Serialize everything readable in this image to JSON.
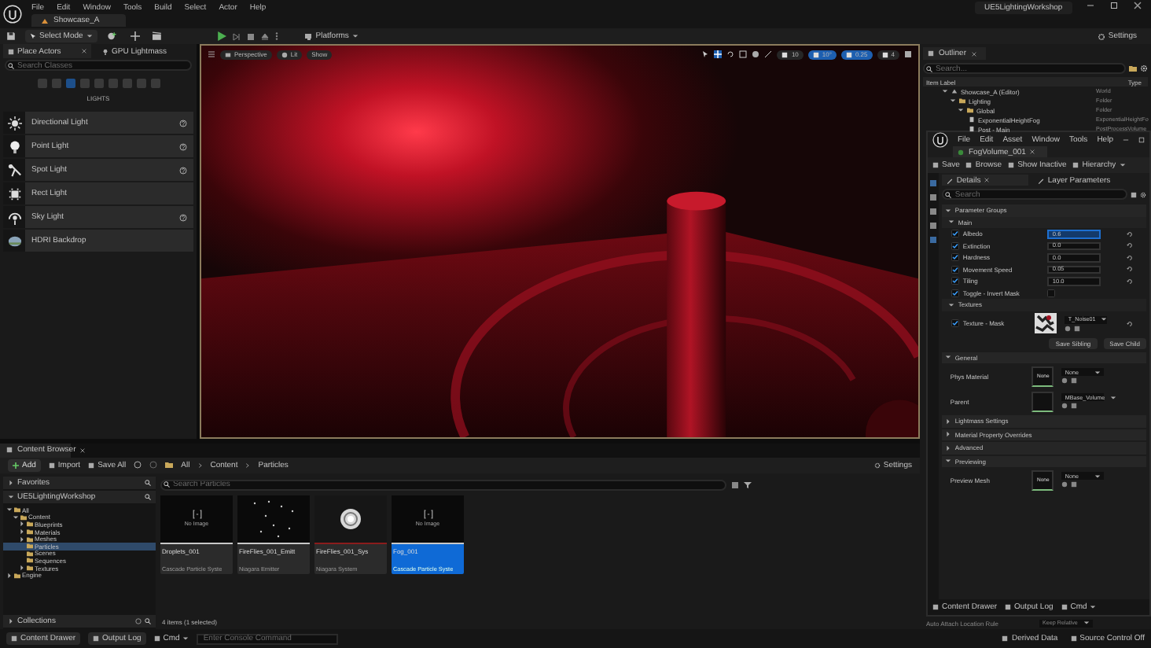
{
  "menu_bar": {
    "items": [
      "File",
      "Edit",
      "Window",
      "Tools",
      "Build",
      "Select",
      "Actor",
      "Help"
    ],
    "project_title": "UE5LightingWorkshop"
  },
  "level_tab": {
    "label": "Showcase_A"
  },
  "toolbar": {
    "mode": "Select Mode",
    "platforms": "Platforms",
    "settings": "Settings"
  },
  "place_actors": {
    "tabs": [
      {
        "label": "Place Actors",
        "selected": true
      },
      {
        "label": "GPU Lightmass",
        "selected": false
      }
    ],
    "search": {
      "placeholder": "Search Classes"
    },
    "category": "LIGHTS",
    "items": [
      {
        "label": "Directional Light",
        "kind": "sun",
        "help": true
      },
      {
        "label": "Point Light",
        "kind": "bulb",
        "help": true
      },
      {
        "label": "Spot Light",
        "kind": "spot",
        "help": true
      },
      {
        "label": "Rect Light",
        "kind": "rect",
        "help": false
      },
      {
        "label": "Sky Light",
        "kind": "sky",
        "help": true
      },
      {
        "label": "HDRI Backdrop",
        "kind": "hdri",
        "help": false
      }
    ]
  },
  "viewport": {
    "view_buttons": [
      "Perspective",
      "Lit",
      "Show"
    ],
    "snap_values": [
      "10",
      "10°",
      "0.25",
      "4"
    ]
  },
  "outliner": {
    "tab": "Outliner",
    "search": {
      "placeholder": "Search..."
    },
    "columns": [
      "Item Label",
      "Type"
    ],
    "rows": [
      {
        "label": "Showcase_A (Editor)",
        "type": "World",
        "kind": "level",
        "children": [
          {
            "label": "Lighting",
            "type": "Folder",
            "kind": "folder",
            "children": [
              {
                "label": "Global",
                "type": "Folder",
                "kind": "folder",
                "children": [
                  {
                    "label": "ExponentialHeightFog",
                    "type": "ExponentialHeightFo",
                    "kind": "actor"
                  },
                  {
                    "label": "Post - Main",
                    "type": "PostProcessVolume",
                    "kind": "actor"
                  }
                ]
              }
            ]
          }
        ]
      }
    ]
  },
  "material_editor": {
    "menu": [
      "File",
      "Edit",
      "Asset",
      "Window",
      "Tools",
      "Help"
    ],
    "asset_tab": "FogVolume_001",
    "toolbar": [
      "Save",
      "Browse",
      "Show Inactive",
      "Hierarchy"
    ],
    "tabs": [
      {
        "label": "Details",
        "selected": true
      },
      {
        "label": "Layer Parameters",
        "selected": false
      }
    ],
    "search": {
      "placeholder": "Search"
    },
    "rows": [
      {
        "kind": "category",
        "label": "Parameter Groups",
        "expanded": true
      },
      {
        "kind": "subcategory",
        "label": "Main",
        "expanded": true
      },
      {
        "kind": "number",
        "label": "Albedo",
        "checked": true,
        "value": "0.6",
        "focused": true
      },
      {
        "kind": "number",
        "label": "Extinction",
        "checked": true,
        "value": "0.0",
        "focused": false
      },
      {
        "kind": "number",
        "label": "Hardness",
        "checked": true,
        "value": "0.0",
        "focused": false
      },
      {
        "kind": "number",
        "label": "Movement Speed",
        "checked": true,
        "value": "0.05",
        "focused": false
      },
      {
        "kind": "number",
        "label": "Tiling",
        "checked": true,
        "value": "10.0",
        "focused": false
      },
      {
        "kind": "toggle",
        "label": "Toggle - Invert Mask",
        "checked": true,
        "on": false
      },
      {
        "kind": "subcategory",
        "label": "Textures",
        "expanded": true
      },
      {
        "kind": "texture",
        "label": "Texture - Mask",
        "checked": true,
        "asset": "T_Noise01"
      },
      {
        "kind": "buttons",
        "labels": [
          "Save Sibling",
          "Save Child"
        ]
      },
      {
        "kind": "category",
        "label": "General",
        "expanded": true
      },
      {
        "kind": "asset",
        "label": "Phys Material",
        "thumb": "None",
        "asset": "None"
      },
      {
        "kind": "asset",
        "label": "Parent",
        "asset": "MBase_Volume"
      },
      {
        "kind": "category",
        "label": "Lightmass Settings",
        "expanded": false
      },
      {
        "kind": "category",
        "label": "Material Property Overrides",
        "expanded": false
      },
      {
        "kind": "category",
        "label": "Advanced",
        "expanded": false
      },
      {
        "kind": "category",
        "label": "Previewing",
        "expanded": true
      },
      {
        "kind": "asset",
        "label": "Preview Mesh",
        "thumb": "None",
        "asset": "None"
      }
    ],
    "bottom_bar": [
      "Content Drawer",
      "Output Log",
      "Cmd"
    ]
  },
  "hidden_details_row": {
    "label": "Auto Attach Location Rule",
    "value": "Keep Relative"
  },
  "content_browser": {
    "tab": "Content Browser",
    "toolbar": [
      "Add",
      "Import",
      "Save All"
    ],
    "path": [
      "All",
      "Content",
      "Particles"
    ],
    "settings": "Settings",
    "sources": [
      "Favorites",
      "UE5LightingWorkshop"
    ],
    "collections": "Collections",
    "search": {
      "placeholder": "Search Particles"
    },
    "tree": [
      {
        "label": "All",
        "expanded": true,
        "selected": false,
        "children": [
          {
            "label": "Content",
            "expanded": true,
            "selected": false,
            "children": [
              {
                "label": "Blueprints",
                "expanded": false,
                "selected": false
              },
              {
                "label": "Materials",
                "expanded": false,
                "selected": false
              },
              {
                "label": "Meshes",
                "expanded": false,
                "selected": false
              },
              {
                "label": "Particles",
                "selected": true
              },
              {
                "label": "Scenes",
                "selected": false
              },
              {
                "label": "Sequences",
                "selected": false
              },
              {
                "label": "Textures",
                "expanded": false,
                "selected": false
              }
            ]
          }
        ]
      },
      {
        "label": "Engine",
        "expanded": false,
        "selected": false
      }
    ],
    "assets": [
      {
        "name": "Droplets_001",
        "type": "Cascade Particle Syste",
        "kind": "no_image",
        "thumbnail_label": "No Image",
        "color": "#c8c8c8",
        "selected": false
      },
      {
        "name": "FireFlies_001_Emitt",
        "type": "Niagara Emitter",
        "kind": "sparkles",
        "color": "#c8c8c8",
        "selected": false
      },
      {
        "name": "FireFlies_001_Sys",
        "type": "Niagara System",
        "kind": "sphere",
        "color": "#8a1c1c",
        "selected": false
      },
      {
        "name": "Fog_001",
        "type": "Cascade Particle Syste",
        "kind": "no_image",
        "thumbnail_label": "No Image",
        "color": "#c8c8c8",
        "selected": true
      }
    ],
    "item_count": "4 items (1 selected)"
  },
  "status_bar": {
    "left": [
      "Content Drawer",
      "Output Log",
      "Cmd"
    ],
    "console": {
      "placeholder": "Enter Console Command"
    },
    "right": [
      "Derived Data",
      "Source Control Off"
    ]
  }
}
